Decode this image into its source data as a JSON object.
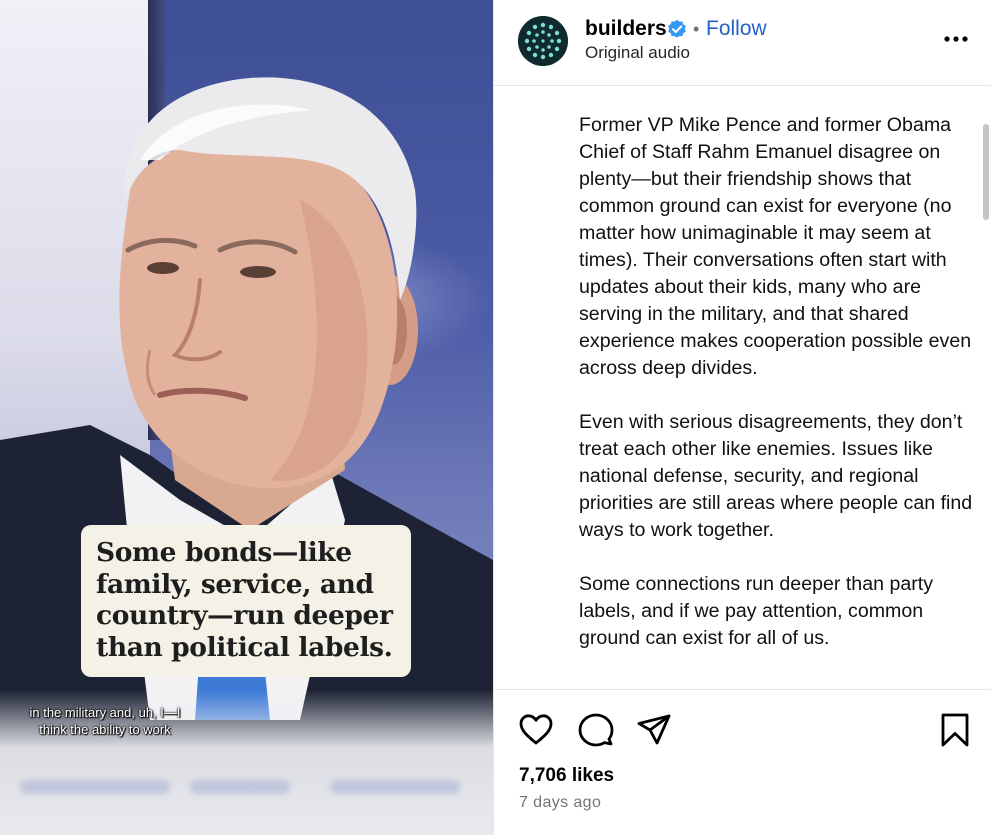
{
  "video": {
    "quote_lines": [
      "Some bonds—like",
      "family, service, and",
      "country—run deeper",
      "than political labels."
    ],
    "subtitle_lines": [
      "in the military and, uh, I—I",
      "think the ability to work"
    ]
  },
  "post": {
    "username": "builders",
    "verified_icon": "verified-badge-icon",
    "separator": "•",
    "follow_label": "Follow",
    "audio_label": "Original audio",
    "more_icon": "more-options-icon",
    "caption_paragraphs": [
      "Former VP Mike Pence and former Obama Chief of Staff Rahm Emanuel disagree on plenty—but their friendship shows that common ground can exist for everyone (no matter how unimaginable it may seem at times). Their conversations often start with updates about their kids, many who are serving in the military, and that shared experience makes cooperation possible even across deep divides.",
      "Even with serious disagreements, they don’t treat each other like enemies. Issues like national defense, security, and regional priorities are still areas where people can find ways to work together.",
      "Some connections run deeper than party labels, and if we pay attention, common ground can exist for all of us."
    ],
    "likes": "7,706 likes",
    "timestamp": "7 days ago",
    "icons": [
      "heart-icon",
      "comment-icon",
      "share-icon",
      "bookmark-icon"
    ]
  },
  "colors": {
    "follow_blue": "#2462c7",
    "verified_blue": "#3897f0",
    "card_bg": "#f4f1e6",
    "muted_text": "#737373"
  }
}
